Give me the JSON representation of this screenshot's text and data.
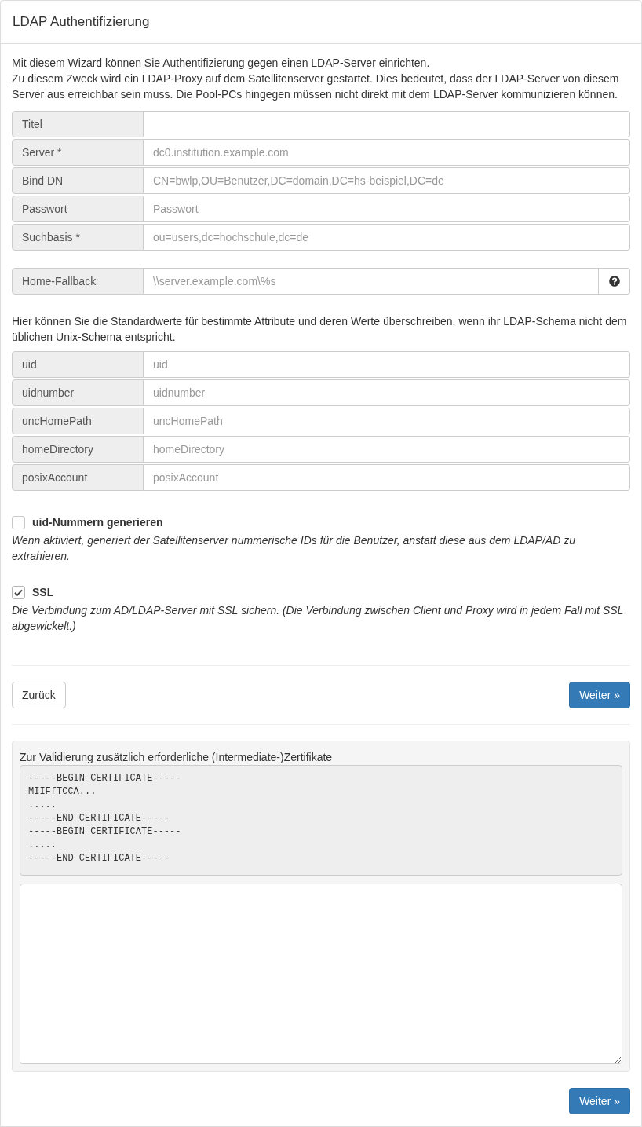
{
  "panel": {
    "title": "LDAP Authentifizierung"
  },
  "intro": [
    "Mit diesem Wizard können Sie Authentifizierung gegen einen LDAP-Server einrichten.",
    "Zu diesem Zweck wird ein LDAP-Proxy auf dem Satellitenserver gestartet. Dies bedeutet, dass der LDAP-Server von diesem Server aus erreichbar sein muss. Die Pool-PCs hingegen müssen nicht direkt mit dem LDAP-Server kommunizieren können."
  ],
  "fields": [
    {
      "label": "Titel"
    },
    {
      "label": "Server *",
      "placeholder": "dc0.institution.example.com"
    },
    {
      "label": "Bind DN",
      "placeholder": "CN=bwlp,OU=Benutzer,DC=domain,DC=hs-beispiel,DC=de"
    },
    {
      "label": "Passwort",
      "placeholder": "Passwort"
    },
    {
      "label": "Suchbasis *",
      "placeholder": "ou=users,dc=hochschule,dc=de"
    }
  ],
  "home_fallback": {
    "label": "Home-Fallback",
    "placeholder": "\\\\server.example.com\\%s"
  },
  "attributes_note": "Hier können Sie die Standardwerte für bestimmte Attribute und deren Werte überschreiben, wenn ihr LDAP-Schema nicht dem üblichen Unix-Schema entspricht.",
  "attribute_fields": [
    {
      "label": "uid",
      "placeholder": "uid"
    },
    {
      "label": "uidnumber",
      "placeholder": "uidnumber"
    },
    {
      "label": "uncHomePath",
      "placeholder": "uncHomePath"
    },
    {
      "label": "homeDirectory",
      "placeholder": "homeDirectory"
    },
    {
      "label": "posixAccount",
      "placeholder": "posixAccount"
    }
  ],
  "options": [
    {
      "label": "uid-Nummern generieren",
      "checked": false,
      "description": "Wenn aktiviert, generiert der Satellitenserver nummerische IDs für die Benutzer, anstatt diese aus dem LDAP/AD zu extrahieren."
    },
    {
      "label": "SSL",
      "checked": true,
      "description": "Die Verbindung zum AD/LDAP-Server mit SSL sichern. (Die Verbindung zwischen Client und Proxy wird in jedem Fall mit SSL abgewickelt.)"
    }
  ],
  "nav": {
    "back": "Zurück",
    "next": "Weiter »"
  },
  "certificates": {
    "label": "Zur Validierung zusätzlich erforderliche (Intermediate-)Zertifikate",
    "example": "-----BEGIN CERTIFICATE-----\nMIIFfTCCA...\n.....\n-----END CERTIFICATE-----\n-----BEGIN CERTIFICATE-----\n.....\n-----END CERTIFICATE-----"
  },
  "footer": {
    "next": "Weiter »"
  }
}
